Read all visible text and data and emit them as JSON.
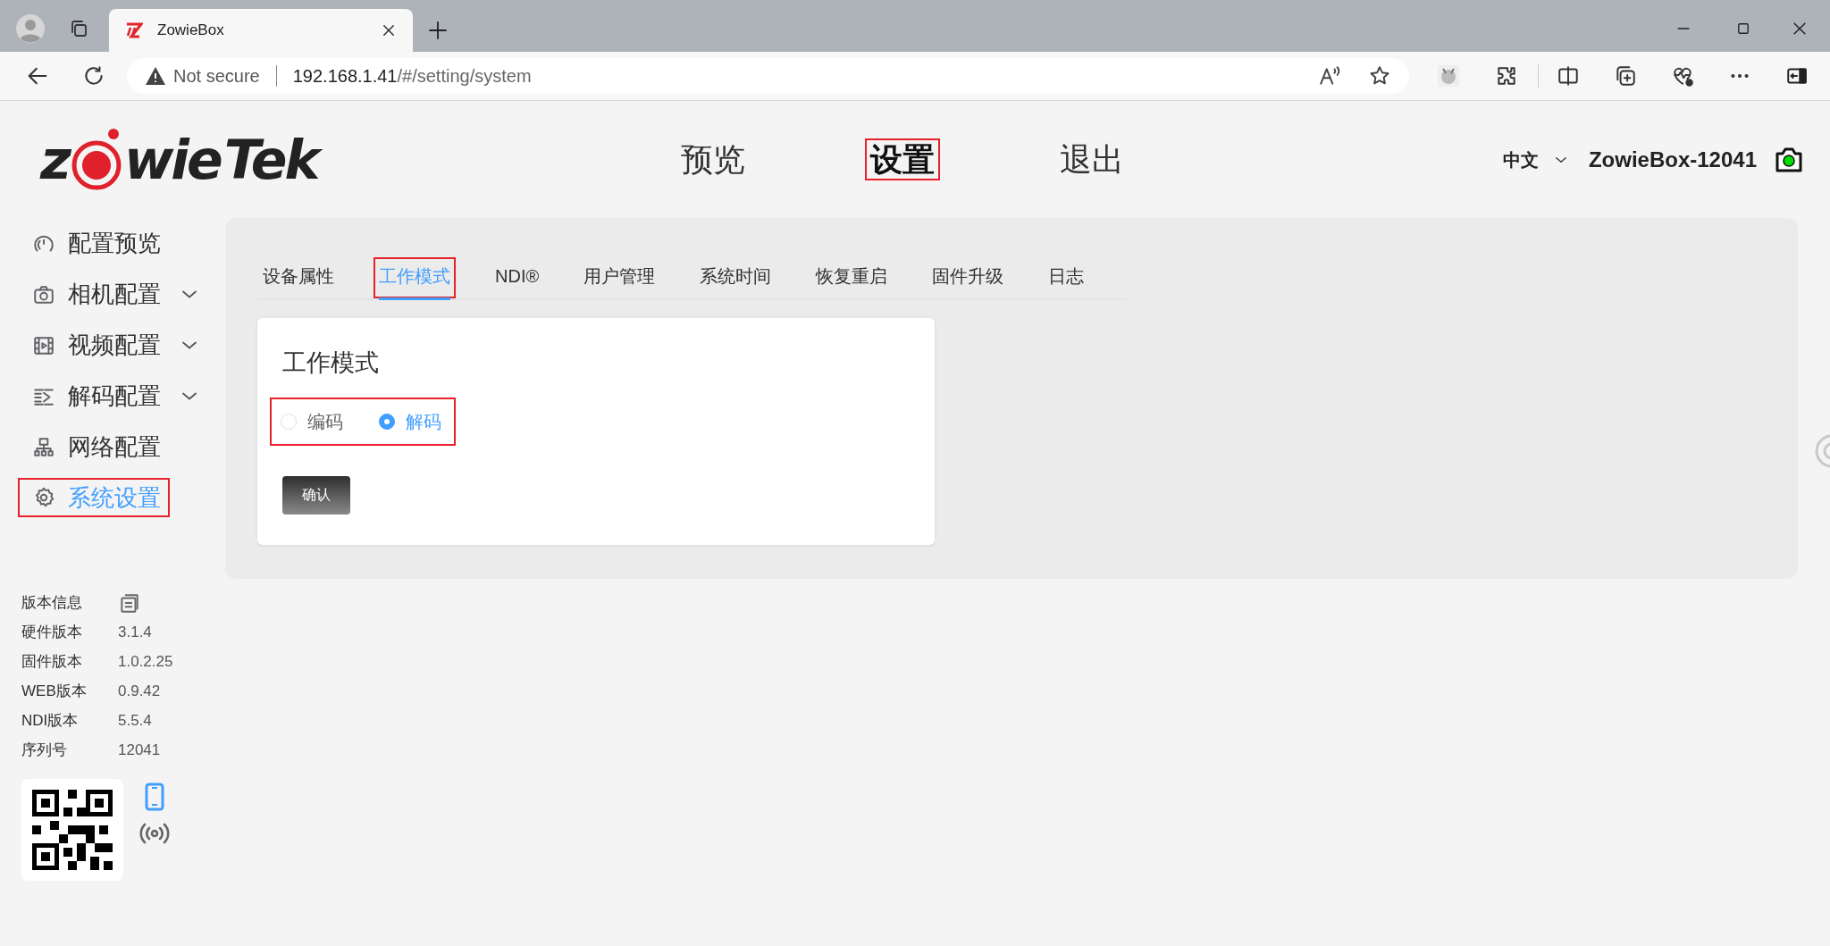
{
  "browser": {
    "tab": {
      "title": "ZowieBox"
    },
    "address": {
      "security": "Not secure",
      "host": "192.168.1.41",
      "path": "/#/setting/system"
    }
  },
  "header": {
    "logo": {
      "before": "z",
      "after": "wie",
      "tail": "Tek"
    },
    "nav": [
      {
        "label": "预览",
        "selected": false,
        "highlighted": false
      },
      {
        "label": "设置",
        "selected": true,
        "highlighted": true
      },
      {
        "label": "退出",
        "selected": false,
        "highlighted": false
      }
    ],
    "language": "中文",
    "device_name": "ZowieBox-12041",
    "camera_online": true
  },
  "sidebar": {
    "items": [
      {
        "kind": "gauge",
        "label": "配置预览",
        "expandable": false,
        "selected": false,
        "highlighted": false
      },
      {
        "kind": "camera",
        "label": "相机配置",
        "expandable": true,
        "selected": false,
        "highlighted": false
      },
      {
        "kind": "film",
        "label": "视频配置",
        "expandable": true,
        "selected": false,
        "highlighted": false
      },
      {
        "kind": "decode",
        "label": "解码配置",
        "expandable": true,
        "selected": false,
        "highlighted": false
      },
      {
        "kind": "network",
        "label": "网络配置",
        "expandable": false,
        "selected": false,
        "highlighted": false
      },
      {
        "kind": "gear",
        "label": "系统设置",
        "expandable": false,
        "selected": true,
        "highlighted": true
      }
    ]
  },
  "version_info": {
    "title": "版本信息",
    "rows": [
      {
        "label": "硬件版本",
        "value": "3.1.4"
      },
      {
        "label": "固件版本",
        "value": "1.0.2.25"
      },
      {
        "label": "WEB版本",
        "value": "0.9.42"
      },
      {
        "label": "NDI版本",
        "value": "5.5.4"
      },
      {
        "label": "序列号",
        "value": "12041"
      }
    ]
  },
  "tabs": [
    {
      "label": "设备属性",
      "selected": false,
      "highlighted": false
    },
    {
      "label": "工作模式",
      "selected": true,
      "highlighted": true
    },
    {
      "label": "NDI®",
      "selected": false,
      "highlighted": false
    },
    {
      "label": "用户管理",
      "selected": false,
      "highlighted": false
    },
    {
      "label": "系统时间",
      "selected": false,
      "highlighted": false
    },
    {
      "label": "恢复重启",
      "selected": false,
      "highlighted": false
    },
    {
      "label": "固件升级",
      "selected": false,
      "highlighted": false
    },
    {
      "label": "日志",
      "selected": false,
      "highlighted": false
    }
  ],
  "card": {
    "title": "工作模式",
    "options_highlighted": true,
    "options": [
      {
        "label": "编码",
        "selected": false
      },
      {
        "label": "解码",
        "selected": true
      }
    ],
    "confirm_button": "确认"
  }
}
